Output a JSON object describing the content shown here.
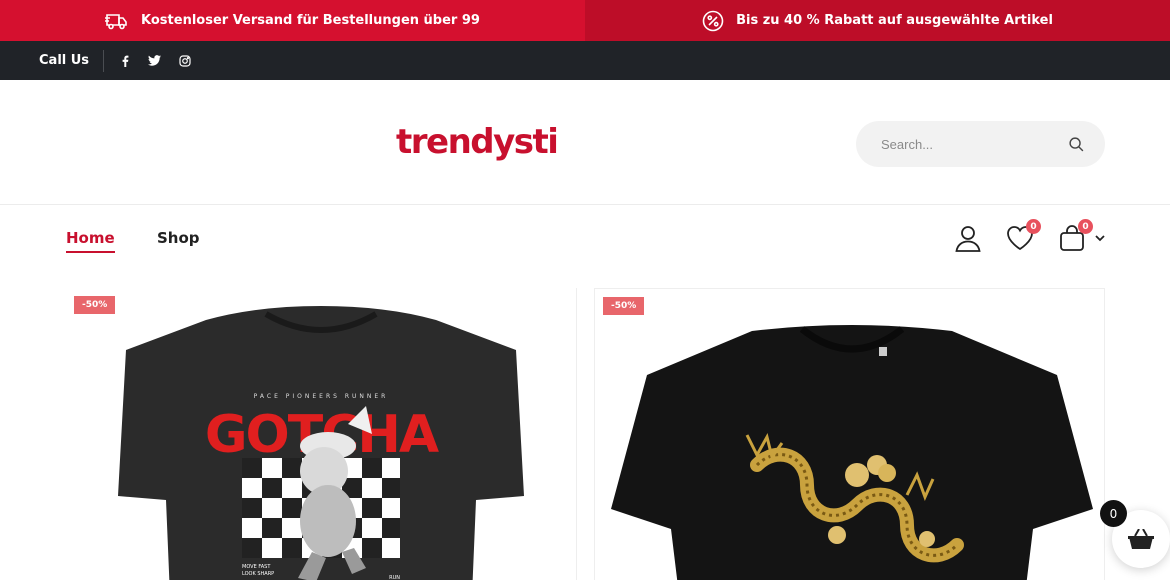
{
  "promo": {
    "left_icon": "truck-icon",
    "left_text": "Kostenloser Versand für Bestellungen über 99",
    "right_icon": "percent-icon",
    "right_text": "Bis zu 40 % Rabatt auf ausgewählte Artikel",
    "colors": {
      "left_bg": "#d5102f",
      "right_bg": "#bd0d28"
    }
  },
  "topbar": {
    "call_label": "Call Us",
    "socials": [
      "facebook-icon",
      "twitter-icon",
      "instagram-icon"
    ]
  },
  "header": {
    "logo": "trendysti",
    "search_placeholder": "Search..."
  },
  "nav": {
    "items": [
      {
        "label": "Home",
        "active": true
      },
      {
        "label": "Shop",
        "active": false
      }
    ],
    "wishlist_count": "0",
    "cart_count": "0"
  },
  "products": [
    {
      "badge": "-50%",
      "image": "black t-shirt with GOTCHA bunny print"
    },
    {
      "badge": "-50%",
      "image": "black t-shirt with golden dragon print"
    }
  ],
  "floating_cart": {
    "count": "0"
  },
  "colors": {
    "accent": "#c8102e",
    "badge": "#e8666b",
    "dark": "#202328"
  }
}
